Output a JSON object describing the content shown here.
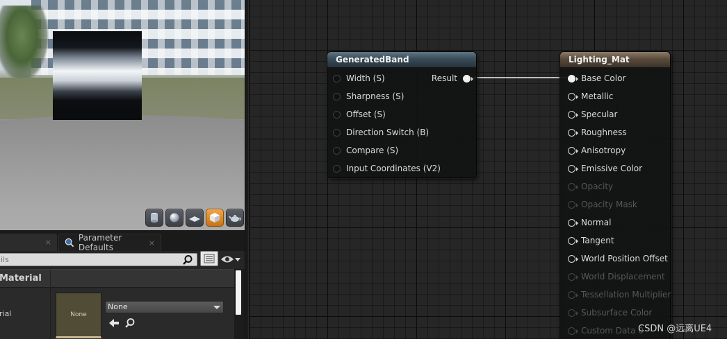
{
  "viewport": {
    "toolbar": [
      {
        "name": "preview-cylinder-button",
        "active": false
      },
      {
        "name": "preview-sphere-button",
        "active": false
      },
      {
        "name": "preview-plane-button",
        "active": false
      },
      {
        "name": "preview-cube-button",
        "active": true
      },
      {
        "name": "preview-custom-mesh-button",
        "active": false
      }
    ]
  },
  "details": {
    "tabs": {
      "details_close": "×",
      "params_label": "Parameter Defaults",
      "params_close": "×"
    },
    "search": {
      "placeholder": "ils"
    },
    "category": {
      "label": "Material"
    },
    "property": {
      "label": "rial",
      "thumbnail_label": "None",
      "selected_asset": "None"
    }
  },
  "graph": {
    "nodes": {
      "generated_band": {
        "title": "GeneratedBand",
        "inputs": [
          "Width (S)",
          "Sharpness (S)",
          "Offset (S)",
          "Direction Switch (B)",
          "Compare (S)",
          "Input Coordinates (V2)"
        ],
        "output": "Result"
      },
      "lighting_mat": {
        "title": "Lighting_Mat",
        "inputs": [
          {
            "label": "Base Color",
            "enabled": true,
            "connected": true
          },
          {
            "label": "Metallic",
            "enabled": true
          },
          {
            "label": "Specular",
            "enabled": true
          },
          {
            "label": "Roughness",
            "enabled": true
          },
          {
            "label": "Anisotropy",
            "enabled": true
          },
          {
            "label": "Emissive Color",
            "enabled": true
          },
          {
            "label": "Opacity",
            "enabled": false
          },
          {
            "label": "Opacity Mask",
            "enabled": false
          },
          {
            "label": "Normal",
            "enabled": true
          },
          {
            "label": "Tangent",
            "enabled": true
          },
          {
            "label": "World Position Offset",
            "enabled": true
          },
          {
            "label": "World Displacement",
            "enabled": false
          },
          {
            "label": "Tessellation Multiplier",
            "enabled": false
          },
          {
            "label": "Subsurface Color",
            "enabled": false
          },
          {
            "label": "Custom Data 0",
            "enabled": false
          }
        ]
      }
    }
  },
  "watermark": "CSDN @远离UE4"
}
